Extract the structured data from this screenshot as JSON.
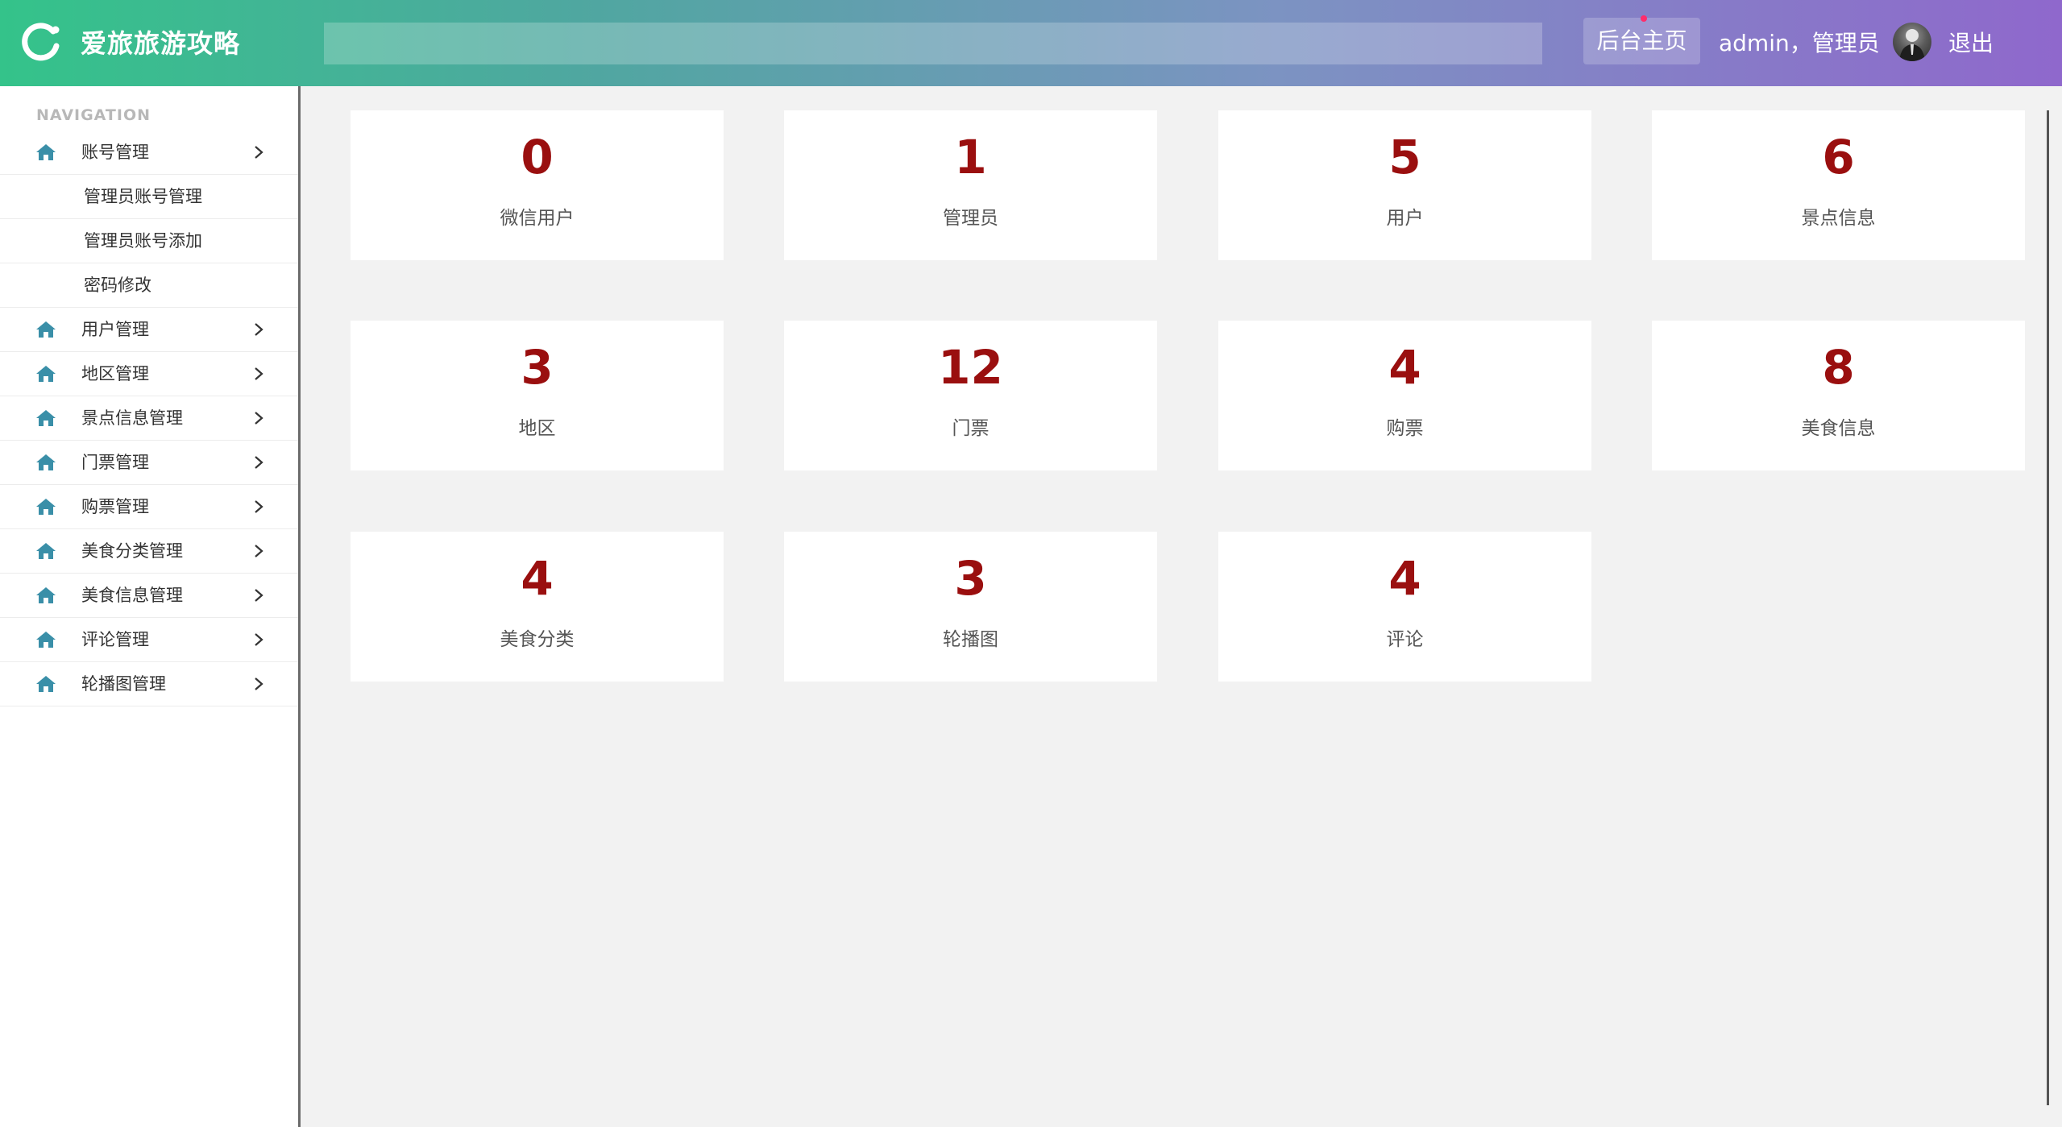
{
  "header": {
    "app_title": "爱旅旅游攻略",
    "search_placeholder": "",
    "home_button": "后台主页",
    "user_label": "admin，管理员",
    "logout": "退出",
    "colors": {
      "gradient_start": "#34c38a",
      "gradient_end": "#8f68cc"
    }
  },
  "sidebar": {
    "caption": "NAVIGATION",
    "items": [
      {
        "label": "账号管理",
        "icon": "home-icon",
        "expanded": true,
        "children": [
          "管理员账号管理",
          "管理员账号添加",
          "密码修改"
        ]
      },
      {
        "label": "用户管理",
        "icon": "home-icon"
      },
      {
        "label": "地区管理",
        "icon": "home-icon"
      },
      {
        "label": "景点信息管理",
        "icon": "home-icon"
      },
      {
        "label": "门票管理",
        "icon": "home-icon"
      },
      {
        "label": "购票管理",
        "icon": "home-icon"
      },
      {
        "label": "美食分类管理",
        "icon": "home-icon"
      },
      {
        "label": "美食信息管理",
        "icon": "home-icon"
      },
      {
        "label": "评论管理",
        "icon": "home-icon"
      },
      {
        "label": "轮播图管理",
        "icon": "home-icon"
      }
    ]
  },
  "stats": [
    {
      "value": "0",
      "label": "微信用户"
    },
    {
      "value": "1",
      "label": "管理员"
    },
    {
      "value": "5",
      "label": "用户"
    },
    {
      "value": "6",
      "label": "景点信息"
    },
    {
      "value": "3",
      "label": "地区"
    },
    {
      "value": "12",
      "label": "门票"
    },
    {
      "value": "4",
      "label": "购票"
    },
    {
      "value": "8",
      "label": "美食信息"
    },
    {
      "value": "4",
      "label": "美食分类"
    },
    {
      "value": "3",
      "label": "轮播图"
    },
    {
      "value": "4",
      "label": "评论"
    }
  ],
  "colors": {
    "stat_value": "#9a0f0f",
    "nav_icon": "#3a8fa8"
  }
}
